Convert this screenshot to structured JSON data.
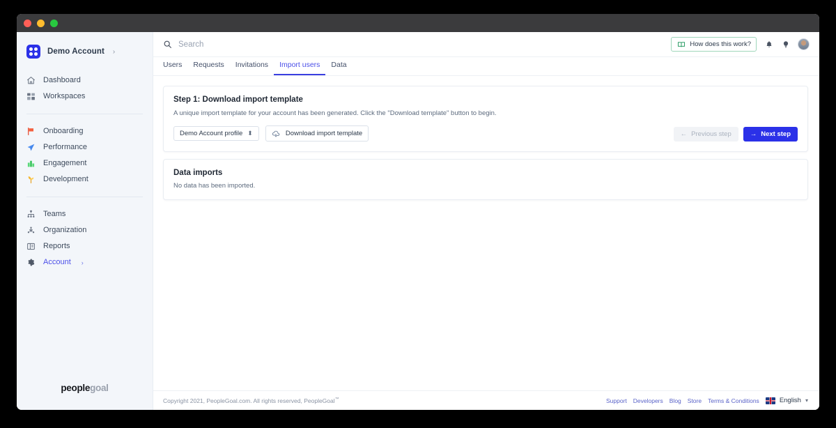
{
  "window": {
    "traffic_lights": [
      "close",
      "minimize",
      "zoom"
    ]
  },
  "sidebar": {
    "account": {
      "name": "Demo Account",
      "chevron": "›",
      "logo_icon": "grid-logo-icon"
    },
    "groups": [
      {
        "items": [
          {
            "label": "Dashboard",
            "icon": "home-icon"
          },
          {
            "label": "Workspaces",
            "icon": "workspaces-icon"
          }
        ]
      },
      {
        "items": [
          {
            "label": "Onboarding",
            "icon": "flag-icon"
          },
          {
            "label": "Performance",
            "icon": "paper-plane-icon"
          },
          {
            "label": "Engagement",
            "icon": "plant-icon"
          },
          {
            "label": "Development",
            "icon": "sprout-icon"
          }
        ]
      },
      {
        "items": [
          {
            "label": "Teams",
            "icon": "teams-icon"
          },
          {
            "label": "Organization",
            "icon": "organization-icon"
          },
          {
            "label": "Reports",
            "icon": "reports-icon"
          },
          {
            "label": "Account",
            "icon": "gear-icon",
            "active": true,
            "chevron": "›"
          }
        ]
      }
    ],
    "brand": {
      "bold": "people",
      "light": "goal"
    }
  },
  "topbar": {
    "search": {
      "placeholder": "Search",
      "value": "",
      "icon": "search-icon"
    },
    "help_button": {
      "label": "How does this work?",
      "icon": "book-icon"
    },
    "notifications_icon": "bell-icon",
    "ideas_icon": "lightbulb-icon",
    "avatar": "user-avatar"
  },
  "tabs": [
    {
      "label": "Users",
      "active": false
    },
    {
      "label": "Requests",
      "active": false
    },
    {
      "label": "Invitations",
      "active": false
    },
    {
      "label": "Import users",
      "active": true
    },
    {
      "label": "Data",
      "active": false
    }
  ],
  "step_card": {
    "title": "Step 1: Download import template",
    "description": "A unique import template for your account has been generated. Click the \"Download template\" button to begin.",
    "profile_select": {
      "value": "Demo Account profile",
      "icon": "updown-chevron-icon"
    },
    "download_button": {
      "label": "Download import template",
      "icon": "cloud-download-icon"
    },
    "previous_button": {
      "label": "Previous step",
      "icon": "arrow-left-icon",
      "disabled": true
    },
    "next_button": {
      "label": "Next step",
      "icon": "arrow-right-icon"
    }
  },
  "imports_card": {
    "title": "Data imports",
    "empty_text": "No data has been imported."
  },
  "footer": {
    "copyright": "Copyright 2021, PeopleGoal.com. All rights reserved, PeopleGoal",
    "trademark": "™",
    "links": [
      "Support",
      "Developers",
      "Blog",
      "Store",
      "Terms & Conditions"
    ],
    "language": {
      "label": "English",
      "flag": "uk-flag-icon",
      "chevron": "▾"
    }
  },
  "colors": {
    "accent_blue": "#2b31e8",
    "active_tab": "#4b4fe8",
    "sidebar_bg": "#f3f6fa",
    "help_border": "#9fd6bb",
    "link": "#5a63c8"
  }
}
